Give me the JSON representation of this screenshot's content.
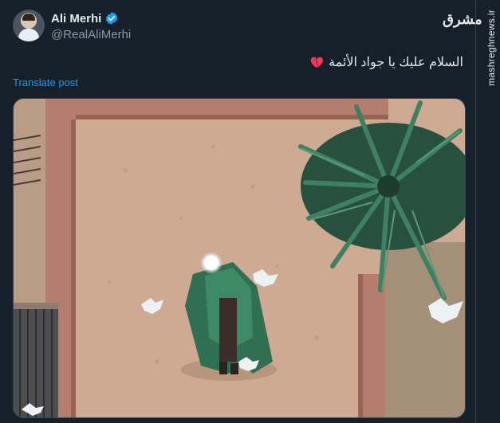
{
  "author": {
    "name": "Ali Merhi",
    "handle": "@RealAliMerhi",
    "verified_icon": "verified-badge-icon",
    "avatar_icon": "profile-avatar"
  },
  "post": {
    "text": "السلام عليك يا جواد الأئمة",
    "emoji_icon": "broken-heart-icon",
    "translate_label": "Translate post"
  },
  "media": {
    "description_icon": "courtyard-illustration"
  },
  "brand": {
    "logo_text": "مشرق",
    "watermark": "mashreghnews.ir"
  },
  "colors": {
    "background": "#15202b",
    "accent": "#1d9bf0",
    "verified": "#1d9bf0",
    "heart": "#f4365a"
  }
}
